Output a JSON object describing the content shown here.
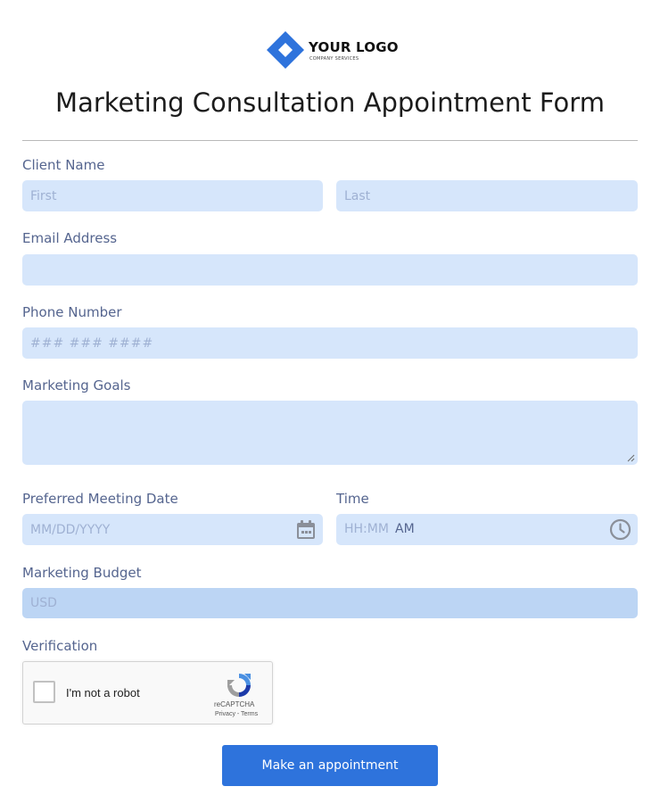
{
  "logo": {
    "name": "YOUR LOGO",
    "tagline": "COMPANY SERVICES",
    "color": "#2e73dc"
  },
  "form": {
    "title": "Marketing Consultation Appointment Form",
    "client_name": {
      "label": "Client Name",
      "first_placeholder": "First",
      "last_placeholder": "Last"
    },
    "email": {
      "label": "Email Address",
      "placeholder": ""
    },
    "phone": {
      "label": "Phone Number",
      "placeholder": "### ### ####"
    },
    "goals": {
      "label": "Marketing Goals"
    },
    "date": {
      "label": "Preferred Meeting Date",
      "placeholder": "MM/DD/YYYY",
      "icon": "calendar-icon"
    },
    "time": {
      "label": "Time",
      "placeholder": "HH:MM",
      "period": "AM",
      "icon": "clock-icon"
    },
    "budget": {
      "label": "Marketing Budget",
      "placeholder": "USD"
    },
    "verification": {
      "label": "Verification",
      "captcha_text": "I'm not a robot",
      "captcha_brand": "reCAPTCHA",
      "captcha_links": "Privacy - Terms"
    },
    "submit_label": "Make an appointment"
  },
  "colors": {
    "accent": "#2e73dc",
    "field_bg": "#d6e6fb",
    "budget_bg": "#bcd5f4",
    "label": "#55658f"
  }
}
